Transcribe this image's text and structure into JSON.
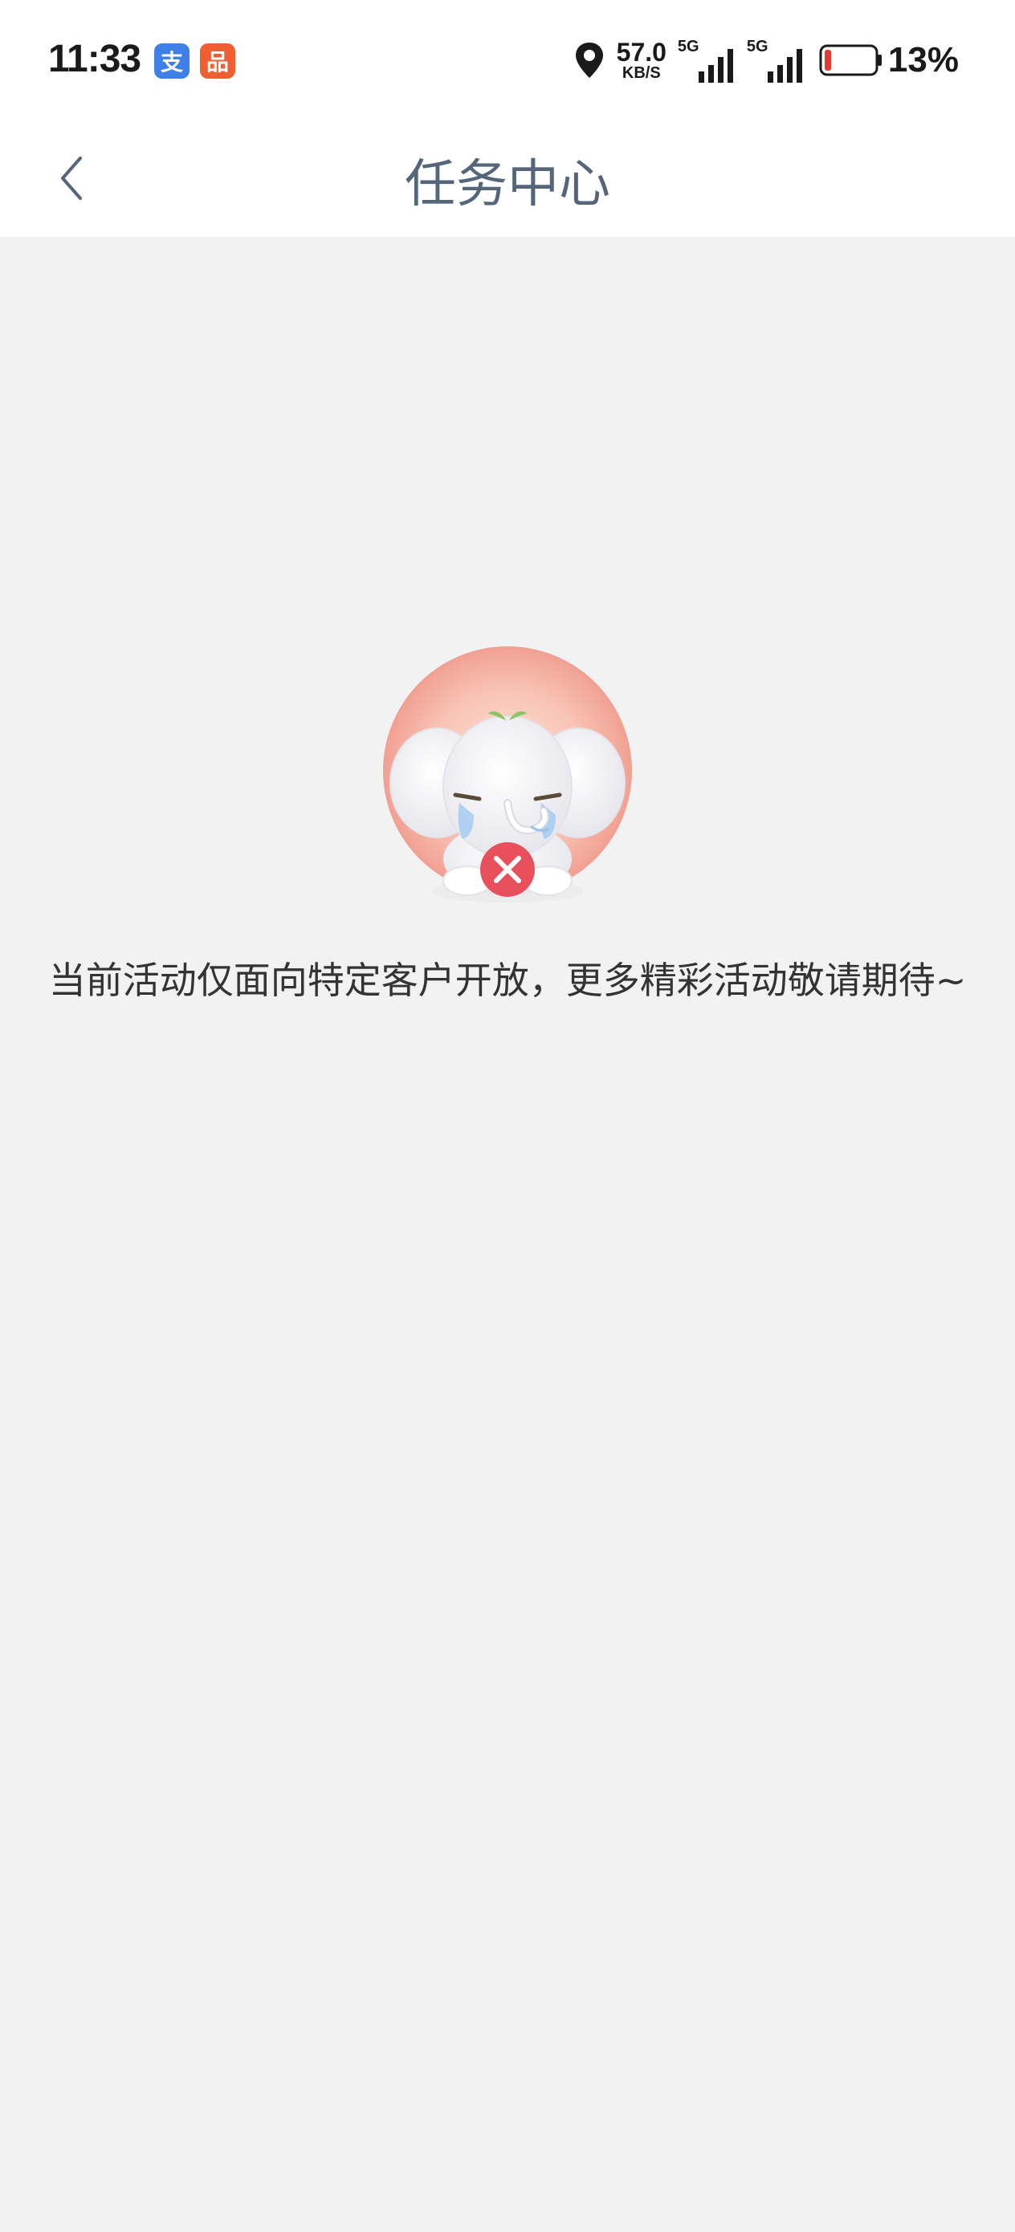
{
  "status_bar": {
    "time": "11:33",
    "app_icons": [
      {
        "name": "alipay-icon",
        "glyph": "支",
        "color": "#3f7fe8"
      },
      {
        "name": "taobao-icon",
        "glyph": "品",
        "color": "#ef5f32"
      }
    ],
    "net_speed_value": "57.0",
    "net_speed_unit": "KB/S",
    "signal_1_label": "5G",
    "signal_2_label": "5G",
    "battery_percent": "13%",
    "battery_level": 0.13,
    "battery_color": "#e53935"
  },
  "nav": {
    "title": "任务中心",
    "back_icon": "chevron-left-icon"
  },
  "empty_state": {
    "illustration": "crying-elephant-icon",
    "message": "当前活动仅面向特定客户开放，更多精彩活动敬请期待~"
  }
}
